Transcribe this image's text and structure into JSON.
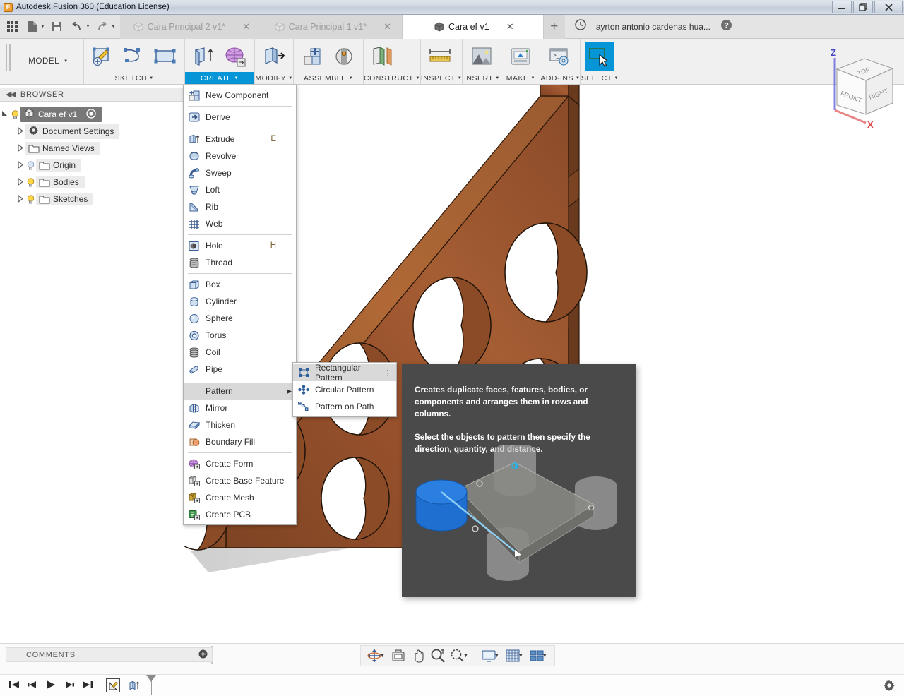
{
  "window": {
    "title": "Autodesk Fusion 360 (Education License)",
    "app_icon": "fusion-logo-icon",
    "minimize": "–",
    "restore": "❐",
    "close": "✕"
  },
  "quick_access": [
    {
      "name": "app-grid",
      "label": "Show Data Panel"
    },
    {
      "name": "file",
      "label": "File"
    },
    {
      "name": "save",
      "label": "Save"
    },
    {
      "name": "undo",
      "label": "Undo"
    },
    {
      "name": "redo",
      "label": "Redo"
    }
  ],
  "tabs": [
    {
      "label": "Cara Principal 2 v1*",
      "active": false,
      "close": "✕"
    },
    {
      "label": "Cara Principal 1 v1*",
      "active": false,
      "close": "✕"
    },
    {
      "label": "Cara ef v1",
      "active": true,
      "close": "✕"
    }
  ],
  "tab_bar": {
    "new_tab": "+",
    "job_status_icon": "clock-icon",
    "user_name": "ayrton antonio cardenas hua...",
    "help_icon": "help-icon"
  },
  "ribbon": {
    "workspace": "MODEL",
    "workspace_caret": "▼",
    "panels": [
      {
        "name": "sketch",
        "label": "SKETCH",
        "caret": "▼",
        "active": false
      },
      {
        "name": "create",
        "label": "CREATE",
        "caret": "▼",
        "active": true
      },
      {
        "name": "modify",
        "label": "MODIFY",
        "caret": "▼",
        "active": false
      },
      {
        "name": "assemble",
        "label": "ASSEMBLE",
        "caret": "▼",
        "active": false
      },
      {
        "name": "construct",
        "label": "CONSTRUCT",
        "caret": "▼",
        "active": false
      },
      {
        "name": "inspect",
        "label": "INSPECT",
        "caret": "▼",
        "active": false
      },
      {
        "name": "insert",
        "label": "INSERT",
        "caret": "▼",
        "active": false
      },
      {
        "name": "make",
        "label": "MAKE",
        "caret": "▼",
        "active": false
      },
      {
        "name": "addins",
        "label": "ADD-INS",
        "caret": "▼",
        "active": false
      },
      {
        "name": "select",
        "label": "SELECT",
        "caret": "▼",
        "active": false
      }
    ]
  },
  "browser": {
    "header": "BROWSER",
    "collapse_icon": "◀◀",
    "root": {
      "label": "Cara ef v1",
      "selected": true
    },
    "items": [
      {
        "label": "Document Settings",
        "icon": "gear-icon",
        "bulb": false
      },
      {
        "label": "Named Views",
        "icon": "folder-icon",
        "bulb": false
      },
      {
        "label": "Origin",
        "icon": "folder-icon",
        "bulb": true,
        "bulb_off": true
      },
      {
        "label": "Bodies",
        "icon": "folder-icon",
        "bulb": true
      },
      {
        "label": "Sketches",
        "icon": "folder-icon",
        "bulb": true
      }
    ]
  },
  "create_menu": {
    "items": [
      {
        "label": "New Component",
        "icon": "new-component-icon",
        "shortcut": "",
        "sep_after": true
      },
      {
        "label": "Derive",
        "icon": "derive-icon",
        "shortcut": "",
        "sep_after": true
      },
      {
        "label": "Extrude",
        "icon": "extrude-icon",
        "shortcut": "E"
      },
      {
        "label": "Revolve",
        "icon": "revolve-icon",
        "shortcut": ""
      },
      {
        "label": "Sweep",
        "icon": "sweep-icon",
        "shortcut": ""
      },
      {
        "label": "Loft",
        "icon": "loft-icon",
        "shortcut": ""
      },
      {
        "label": "Rib",
        "icon": "rib-icon",
        "shortcut": ""
      },
      {
        "label": "Web",
        "icon": "web-icon",
        "shortcut": "",
        "sep_after": true
      },
      {
        "label": "Hole",
        "icon": "hole-icon",
        "shortcut": "H"
      },
      {
        "label": "Thread",
        "icon": "thread-icon",
        "shortcut": "",
        "sep_after": true
      },
      {
        "label": "Box",
        "icon": "box-icon",
        "shortcut": ""
      },
      {
        "label": "Cylinder",
        "icon": "cylinder-icon",
        "shortcut": ""
      },
      {
        "label": "Sphere",
        "icon": "sphere-icon",
        "shortcut": ""
      },
      {
        "label": "Torus",
        "icon": "torus-icon",
        "shortcut": ""
      },
      {
        "label": "Coil",
        "icon": "coil-icon",
        "shortcut": ""
      },
      {
        "label": "Pipe",
        "icon": "pipe-icon",
        "shortcut": "",
        "sep_after": true
      },
      {
        "label": "Pattern",
        "icon": "",
        "shortcut": "",
        "submenu": "▶",
        "highlighted": true
      },
      {
        "label": "Mirror",
        "icon": "mirror-icon",
        "shortcut": ""
      },
      {
        "label": "Thicken",
        "icon": "thicken-icon",
        "shortcut": ""
      },
      {
        "label": "Boundary Fill",
        "icon": "boundary-fill-icon",
        "shortcut": "",
        "sep_after": true
      },
      {
        "label": "Create Form",
        "icon": "create-form-icon",
        "shortcut": ""
      },
      {
        "label": "Create Base Feature",
        "icon": "create-base-feature-icon",
        "shortcut": ""
      },
      {
        "label": "Create Mesh",
        "icon": "create-mesh-icon",
        "shortcut": ""
      },
      {
        "label": "Create PCB",
        "icon": "create-pcb-icon",
        "shortcut": ""
      }
    ]
  },
  "pattern_submenu": {
    "items": [
      {
        "label": "Rectangular Pattern",
        "icon": "rectangular-pattern-icon",
        "highlighted": true,
        "overflow": "⋮"
      },
      {
        "label": "Circular Pattern",
        "icon": "circular-pattern-icon",
        "highlighted": false,
        "overflow": ""
      },
      {
        "label": "Pattern on Path",
        "icon": "pattern-on-path-icon",
        "highlighted": false,
        "overflow": ""
      }
    ]
  },
  "tooltip": {
    "paragraph1": "Creates duplicate faces, features, bodies, or components and arranges them in rows and columns.",
    "paragraph2": "Select the objects to pattern then specify the direction, quantity, and distance."
  },
  "viewcube": {
    "faces": {
      "top": "TOP",
      "front": "FRONT",
      "right": "RIGHT"
    },
    "axes": {
      "z": "Z",
      "x": "X"
    },
    "z_color": "#4444ee",
    "x_color": "#ee4444"
  },
  "canvas": {
    "model_color": "#8a4b28",
    "model_highlight": "#b2estimate",
    "background": "#ffffff"
  },
  "nav_toolbar": [
    {
      "name": "orbit",
      "label": "Orbit",
      "caret": "▼"
    },
    {
      "name": "look-at",
      "label": "Look At",
      "caret": ""
    },
    {
      "name": "pan",
      "label": "Pan",
      "caret": ""
    },
    {
      "name": "zoom",
      "label": "Zoom",
      "caret": ""
    },
    {
      "name": "fit",
      "label": "Fit",
      "caret": "▼"
    },
    {
      "name": "display-settings",
      "label": "Display Settings",
      "caret": "▼"
    },
    {
      "name": "grid-snaps",
      "label": "Grid and Snaps",
      "caret": "▼"
    },
    {
      "name": "viewports",
      "label": "Viewports",
      "caret": "▼"
    }
  ],
  "comments": {
    "label": "COMMENTS",
    "add": "✛"
  },
  "timeline": {
    "go_to_beginning": "◀◀|",
    "step_back": "◀|",
    "play": "▶",
    "step_forward": "|▶",
    "go_to_end": "▶▶|",
    "features": [
      "sketch-feature-icon",
      "extrude-feature-icon"
    ]
  },
  "status_bar": {
    "settings_icon": "gear-icon"
  }
}
